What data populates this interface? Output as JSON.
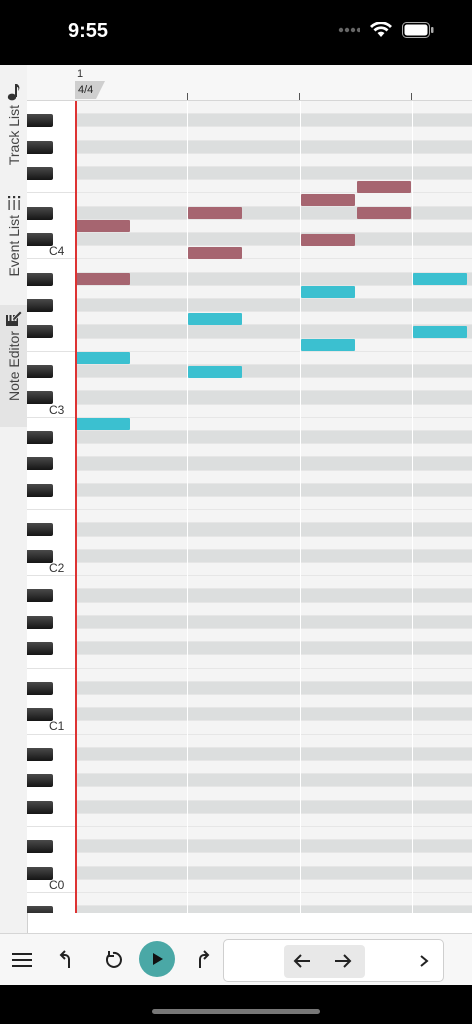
{
  "status_bar": {
    "time": "9:55"
  },
  "tabs": [
    {
      "label": "Track List",
      "icon": "music-note-icon",
      "active": false
    },
    {
      "label": "Event List",
      "icon": "list-icon",
      "active": false
    },
    {
      "label": "Note Editor",
      "icon": "piano-edit-icon",
      "active": true
    }
  ],
  "ruler": {
    "bar": "1",
    "time_signature": "4/4"
  },
  "piano": {
    "octave_labels": [
      "C4",
      "C3",
      "C2",
      "C1",
      "C0"
    ]
  },
  "notes": [
    {
      "pitch": 62,
      "beat": 0,
      "length": 0.5,
      "velocity": "high"
    },
    {
      "pitch": 58,
      "beat": 0,
      "length": 0.5,
      "velocity": "high"
    },
    {
      "pitch": 52,
      "beat": 0,
      "length": 0.5,
      "velocity": "low"
    },
    {
      "pitch": 47,
      "beat": 0,
      "length": 0.5,
      "velocity": "low"
    },
    {
      "pitch": 63,
      "beat": 1,
      "length": 0.5,
      "velocity": "high"
    },
    {
      "pitch": 60,
      "beat": 1,
      "length": 0.5,
      "velocity": "high"
    },
    {
      "pitch": 55,
      "beat": 1,
      "length": 0.5,
      "velocity": "low"
    },
    {
      "pitch": 51,
      "beat": 1,
      "length": 0.5,
      "velocity": "low"
    },
    {
      "pitch": 64,
      "beat": 2,
      "length": 0.5,
      "velocity": "high"
    },
    {
      "pitch": 61,
      "beat": 2,
      "length": 0.5,
      "velocity": "high"
    },
    {
      "pitch": 57,
      "beat": 2,
      "length": 0.5,
      "velocity": "low"
    },
    {
      "pitch": 53,
      "beat": 2,
      "length": 0.5,
      "velocity": "low"
    },
    {
      "pitch": 65,
      "beat": 2.5,
      "length": 0.5,
      "velocity": "high"
    },
    {
      "pitch": 63,
      "beat": 2.5,
      "length": 0.5,
      "velocity": "high"
    },
    {
      "pitch": 58,
      "beat": 3,
      "length": 0.5,
      "velocity": "low"
    },
    {
      "pitch": 54,
      "beat": 3,
      "length": 0.5,
      "velocity": "low"
    }
  ],
  "colors": {
    "note_high": "#a66570",
    "note_low": "#3bc0d0",
    "playhead": "#dd3333",
    "play_button": "#4aa8a6"
  },
  "toolbar": {
    "items": [
      "menu-icon",
      "undo-icon",
      "rewind-icon",
      "play-icon",
      "redo-icon",
      "arrow-left-icon",
      "arrow-right-icon",
      "chevron-right-icon"
    ]
  }
}
